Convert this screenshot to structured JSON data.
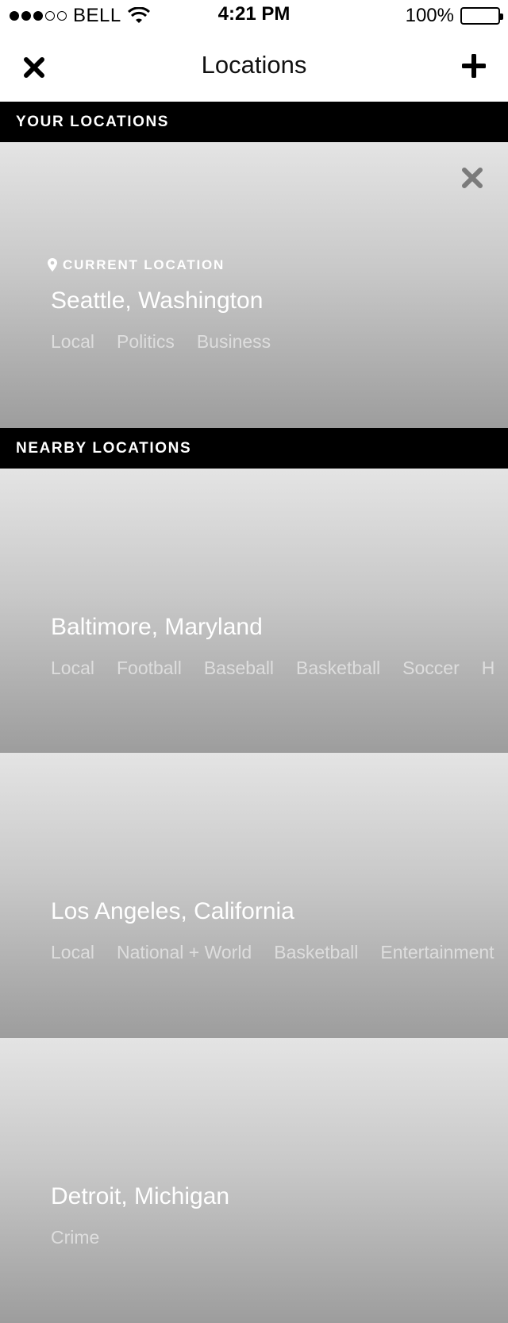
{
  "status_bar": {
    "carrier": "BELL",
    "time": "4:21 PM",
    "battery": "100%"
  },
  "nav": {
    "title": "Locations"
  },
  "sections": {
    "yours": "YOUR LOCATIONS",
    "nearby": "NEARBY LOCATIONS"
  },
  "current": {
    "badge": "CURRENT LOCATION",
    "city": "Seattle, Washington",
    "topics": [
      "Local",
      "Politics",
      "Business"
    ]
  },
  "nearby": [
    {
      "city": "Baltimore, Maryland",
      "topics": [
        "Local",
        "Football",
        "Baseball",
        "Basketball",
        "Soccer",
        "H"
      ]
    },
    {
      "city": "Los Angeles, California",
      "topics": [
        "Local",
        "National + World",
        "Basketball",
        "Entertainment"
      ]
    },
    {
      "city": "Detroit, Michigan",
      "topics": [
        "Crime"
      ]
    }
  ]
}
